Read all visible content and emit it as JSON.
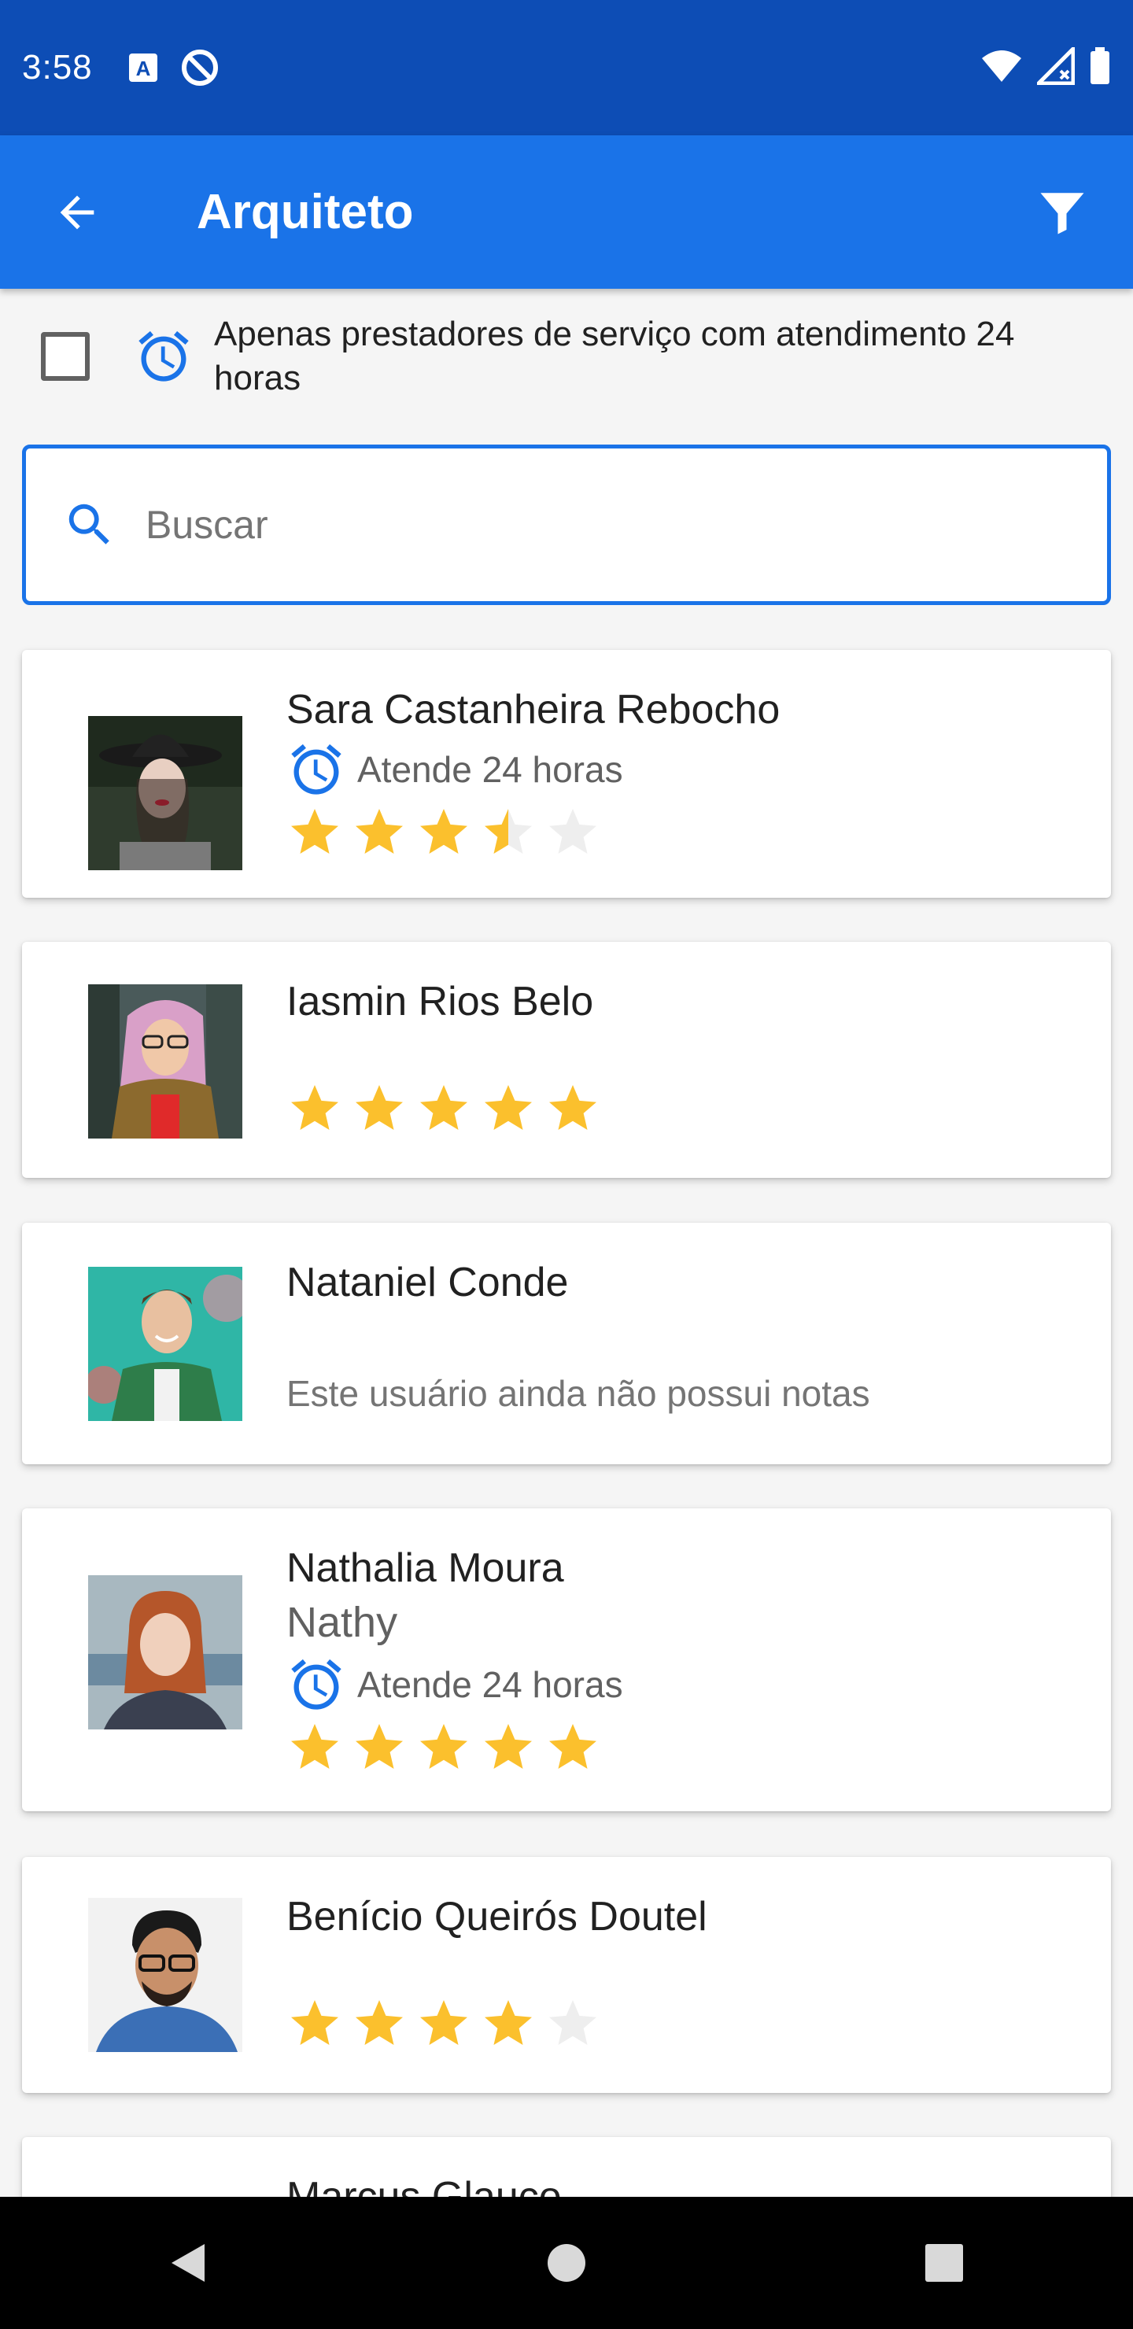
{
  "status_bar": {
    "time": "3:58"
  },
  "app_bar": {
    "title": "Arquiteto"
  },
  "filter": {
    "label": "Apenas prestadores de serviço com atendimento 24 horas",
    "checked": false
  },
  "search": {
    "placeholder": "Buscar",
    "value": ""
  },
  "colors": {
    "primary": "#1a73e8",
    "status": "#0d4db5",
    "star": "#fbc02d",
    "star_empty": "#eeeeee"
  },
  "providers": [
    {
      "name": "Sara Castanheira Rebocho",
      "nickname": "",
      "attends_24h": true,
      "attends_label": "Atende 24 horas",
      "rating": 3.5,
      "no_rating_text": ""
    },
    {
      "name": "Iasmin Rios Belo",
      "nickname": "",
      "attends_24h": false,
      "attends_label": "",
      "rating": 5,
      "no_rating_text": ""
    },
    {
      "name": "Nataniel Conde",
      "nickname": "",
      "attends_24h": false,
      "attends_label": "",
      "rating": null,
      "no_rating_text": "Este usuário ainda não possui notas"
    },
    {
      "name": "Nathalia Moura",
      "nickname": "Nathy",
      "attends_24h": true,
      "attends_label": "Atende 24 horas",
      "rating": 5,
      "no_rating_text": ""
    },
    {
      "name": "Benício Queirós Doutel",
      "nickname": "",
      "attends_24h": false,
      "attends_label": "",
      "rating": 4,
      "no_rating_text": ""
    },
    {
      "name": "Marcus Glauco",
      "nickname": "",
      "attends_24h": false,
      "attends_label": "",
      "rating": null,
      "no_rating_text": ""
    }
  ]
}
